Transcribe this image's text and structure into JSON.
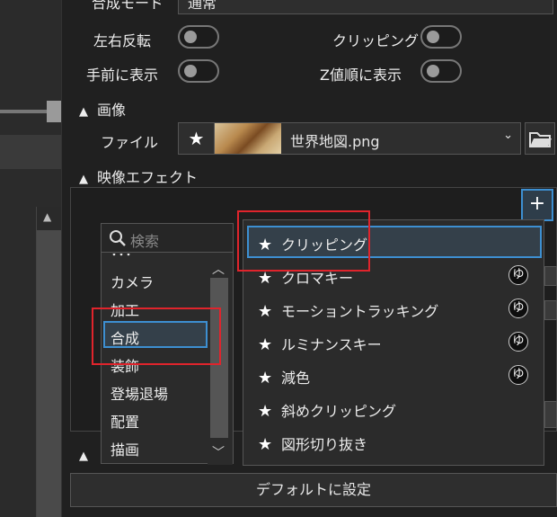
{
  "blend": {
    "label": "合成モード",
    "value": "通常"
  },
  "toggles": [
    {
      "label": "左右反転"
    },
    {
      "label": "クリッピング"
    },
    {
      "label": "手前に表示"
    },
    {
      "label": "Z値順に表示"
    }
  ],
  "image_section": {
    "title": "画像",
    "file_label": "ファイル",
    "file_name": "世界地図.png"
  },
  "effect_section": {
    "title": "映像エフェクト",
    "add_label": "+"
  },
  "category_list": {
    "search_placeholder": "検索",
    "items": [
      "カメラ",
      "加工",
      "合成",
      "装飾",
      "登場退場",
      "配置",
      "描画"
    ],
    "selected": "合成"
  },
  "effect_list": {
    "items": [
      {
        "label": "クリッピング",
        "badge": ""
      },
      {
        "label": "クロマキー",
        "badge": "ゆ"
      },
      {
        "label": "モーショントラッキング",
        "badge": "ゆ"
      },
      {
        "label": "ルミナンスキー",
        "badge": "ゆ"
      },
      {
        "label": "減色",
        "badge": "ゆ"
      },
      {
        "label": "斜めクリッピング",
        "badge": ""
      },
      {
        "label": "図形切り抜き",
        "badge": ""
      }
    ]
  },
  "default_button": "デフォルトに設定",
  "colors": {
    "accent": "#3d8fd1",
    "highlight": "#e0242c"
  }
}
